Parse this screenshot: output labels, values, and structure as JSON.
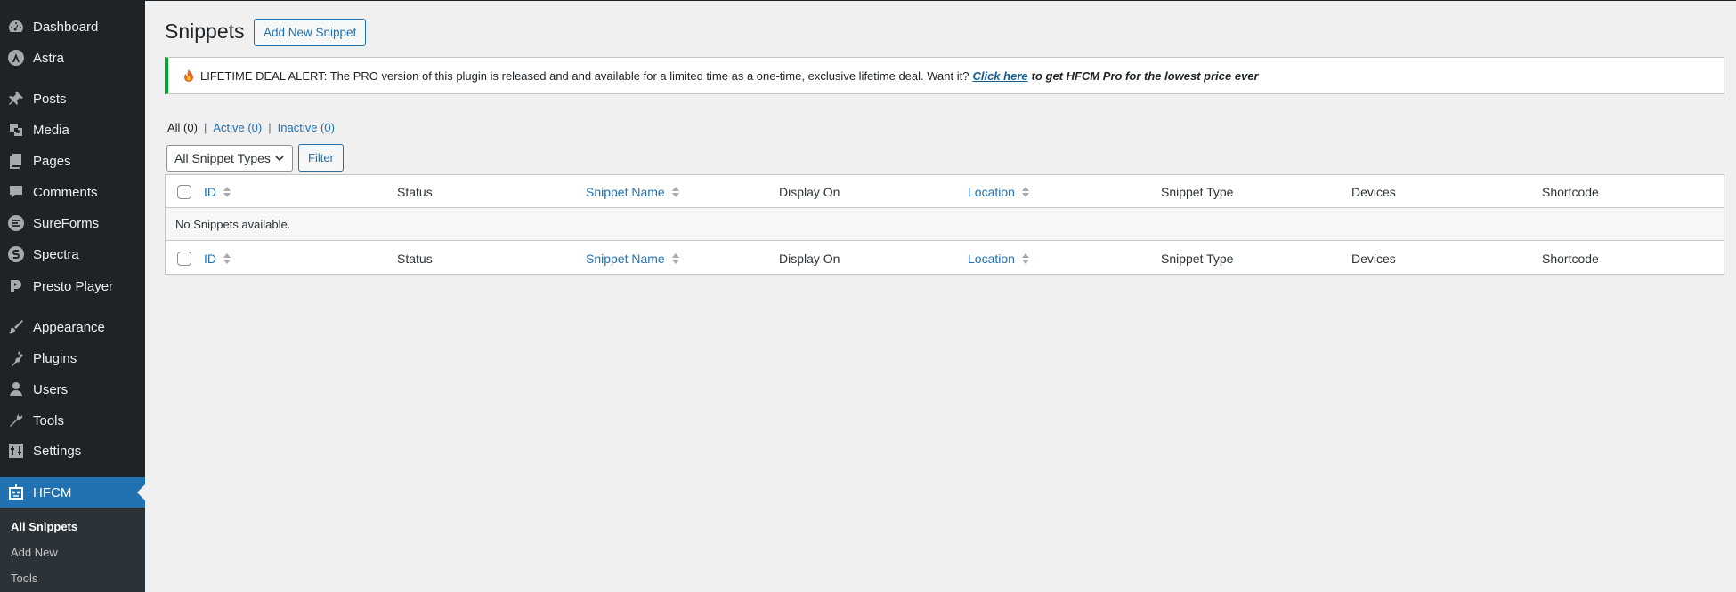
{
  "sidebar": {
    "items": [
      {
        "label": "Dashboard",
        "icon": "dashboard-icon"
      },
      {
        "label": "Astra",
        "icon": "astra-icon"
      },
      {
        "label": "Posts",
        "icon": "pin-icon"
      },
      {
        "label": "Media",
        "icon": "media-icon"
      },
      {
        "label": "Pages",
        "icon": "pages-icon"
      },
      {
        "label": "Comments",
        "icon": "comment-icon"
      },
      {
        "label": "SureForms",
        "icon": "sureforms-icon"
      },
      {
        "label": "Spectra",
        "icon": "spectra-icon"
      },
      {
        "label": "Presto Player",
        "icon": "presto-player-icon"
      },
      {
        "label": "Appearance",
        "icon": "paintbrush-icon"
      },
      {
        "label": "Plugins",
        "icon": "plugin-icon"
      },
      {
        "label": "Users",
        "icon": "user-icon"
      },
      {
        "label": "Tools",
        "icon": "wrench-icon"
      },
      {
        "label": "Settings",
        "icon": "settings-icon"
      },
      {
        "label": "HFCM",
        "icon": "robot-icon",
        "active": true
      }
    ],
    "submenu": [
      {
        "label": "All Snippets",
        "current": true
      },
      {
        "label": "Add New"
      },
      {
        "label": "Tools"
      }
    ]
  },
  "header": {
    "title": "Snippets",
    "add_new_label": "Add New Snippet"
  },
  "notice": {
    "text": "LIFETIME DEAL ALERT: The PRO version of this plugin is released and and available for a limited time as a one-time, exclusive lifetime deal. Want it?",
    "link_text": "Click here",
    "tail_text": "to get HFCM Pro for the lowest price ever",
    "border_color": "#00a32a"
  },
  "views": {
    "all": "All (0)",
    "active": "Active (0)",
    "inactive": "Inactive (0)",
    "separator": "|"
  },
  "filters": {
    "type_select": "All Snippet Types",
    "filter_button": "Filter"
  },
  "table": {
    "columns": [
      {
        "label": "ID",
        "sortable": true
      },
      {
        "label": "Status",
        "sortable": false
      },
      {
        "label": "Snippet Name",
        "sortable": true
      },
      {
        "label": "Display On",
        "sortable": false
      },
      {
        "label": "Location",
        "sortable": true
      },
      {
        "label": "Snippet Type",
        "sortable": false
      },
      {
        "label": "Devices",
        "sortable": false
      },
      {
        "label": "Shortcode",
        "sortable": false
      }
    ],
    "empty_message": "No Snippets available."
  },
  "colors": {
    "sidebar_bg": "#1d2327",
    "accent": "#2271b1",
    "page_bg": "#f0f0f1"
  }
}
